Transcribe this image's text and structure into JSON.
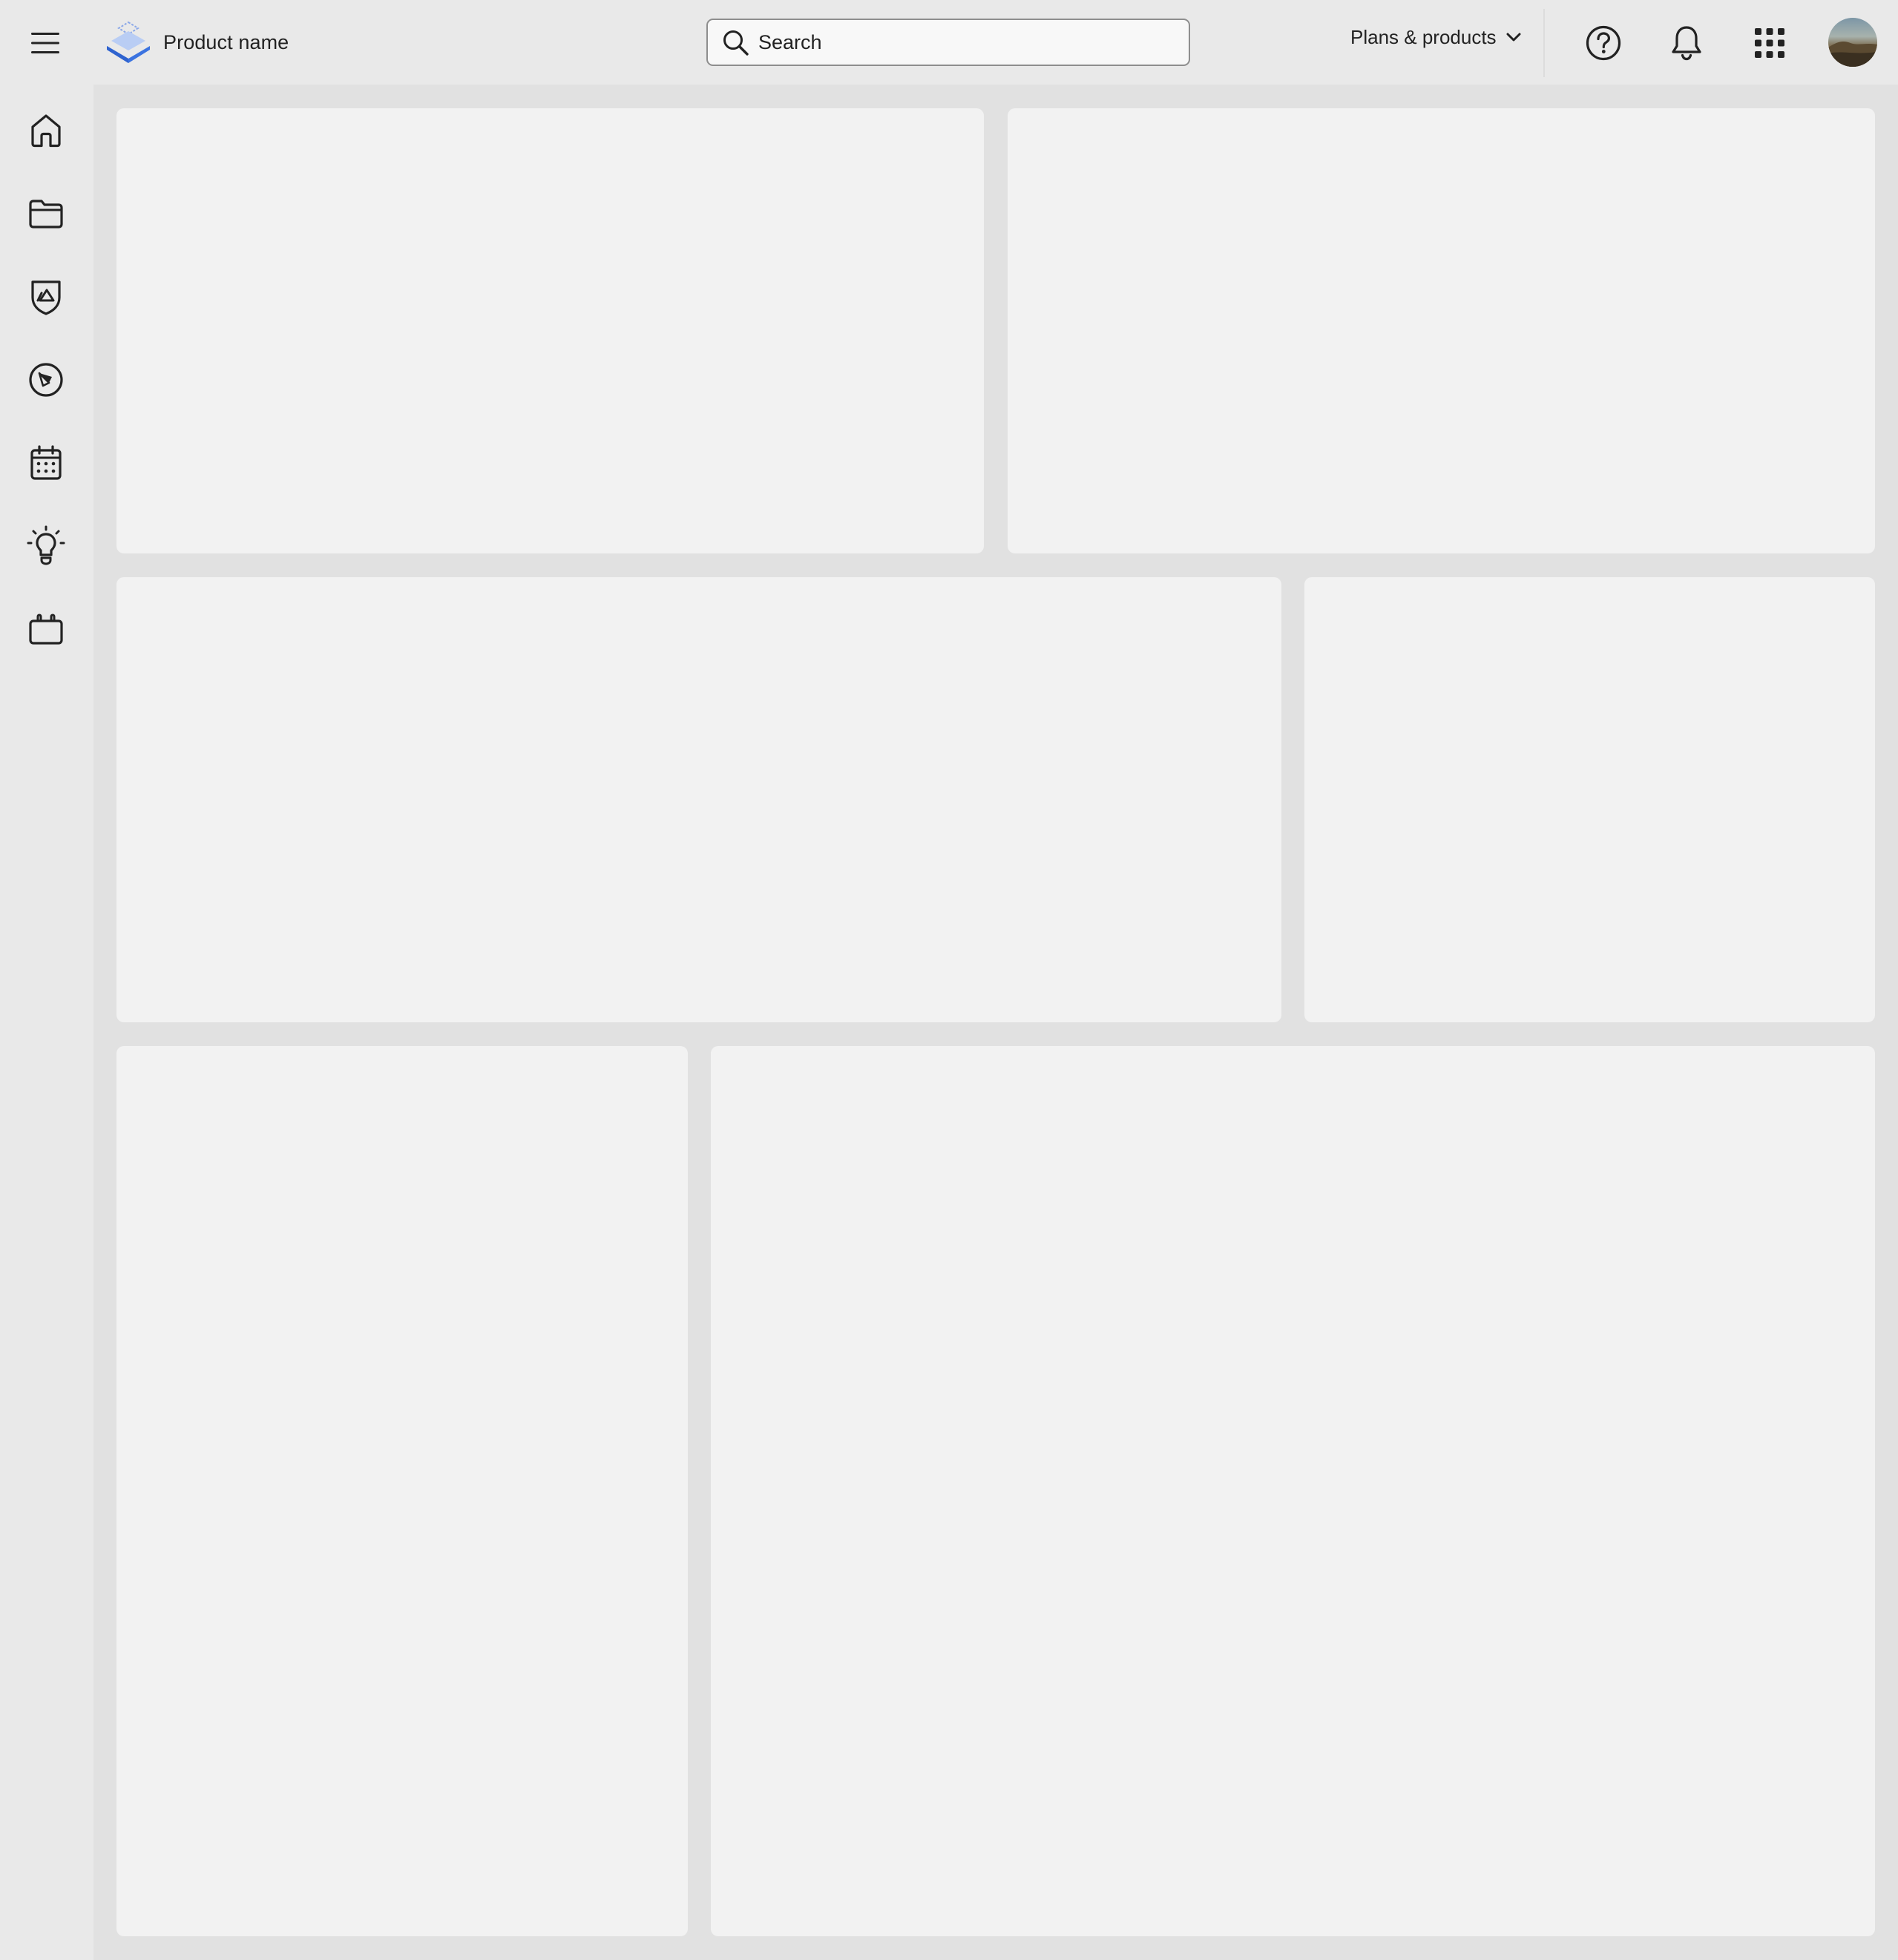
{
  "header": {
    "product_name": "Product name",
    "search": {
      "placeholder": "Search",
      "value": ""
    },
    "plans_label": "Plans & products"
  },
  "icons": {
    "menu": "hamburger-menu-icon",
    "logo": "layered-stack-logo-icon",
    "search": "search-icon",
    "chevron": "chevron-down-icon",
    "help": "help-circle-icon",
    "notifications": "bell-icon",
    "apps": "app-grid-icon",
    "avatar": "user-avatar"
  },
  "sidebar": {
    "items": [
      {
        "id": "home",
        "icon": "home-icon"
      },
      {
        "id": "files",
        "icon": "folder-icon"
      },
      {
        "id": "brand",
        "icon": "shield-image-icon"
      },
      {
        "id": "discover",
        "icon": "compass-icon"
      },
      {
        "id": "calendar",
        "icon": "calendar-icon"
      },
      {
        "id": "learn",
        "icon": "lightbulb-icon"
      },
      {
        "id": "portfolio",
        "icon": "briefcase-icon"
      }
    ]
  },
  "colors": {
    "header_bg": "#e9e9e9",
    "main_bg": "#e1e1e1",
    "card_bg": "#f2f2f2",
    "text": "#222222",
    "logo_blue": "#3b73e0"
  }
}
